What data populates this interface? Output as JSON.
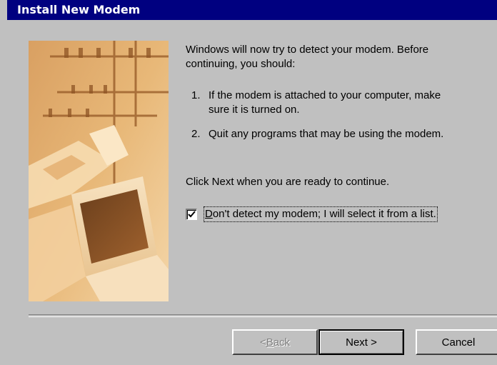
{
  "window": {
    "title": "Install New Modem"
  },
  "content": {
    "intro": "Windows will now try to detect your modem.  Before continuing, you should:",
    "steps": [
      {
        "num": "1.",
        "text": "If the modem is attached to your computer, make sure it is turned on."
      },
      {
        "num": "2.",
        "text": "Quit any programs that may be using the modem."
      }
    ],
    "ready": "Click Next when you are ready to continue."
  },
  "checkbox": {
    "checked": true,
    "label_first": "D",
    "label_rest": "on't detect my modem; I will select it from a list."
  },
  "buttons": {
    "back_prefix": "< ",
    "back_hotkey": "B",
    "back_rest": "ack",
    "back_enabled": false,
    "next": "Next >",
    "cancel": "Cancel"
  },
  "colors": {
    "titlebar": "#000080",
    "face": "#c0c0c0",
    "image_tone": "#e8b878"
  },
  "icons": {
    "checkbox_mark": "checkmark-icon"
  }
}
